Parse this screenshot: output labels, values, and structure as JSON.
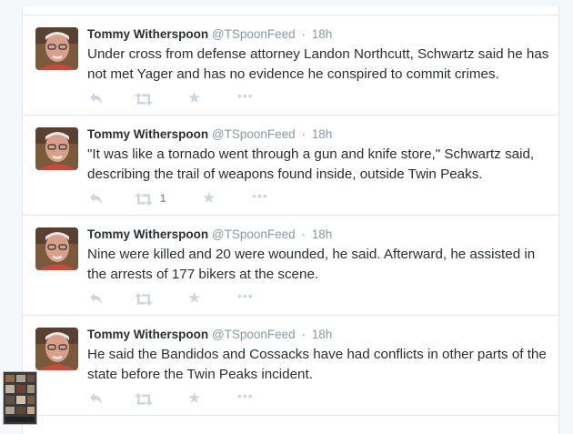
{
  "colors": {
    "background": "#f5f8fa",
    "card": "#ffffff",
    "border": "#e1e8ed",
    "name": "#292f33",
    "muted": "#8899a6",
    "icon": "#ccd6dd"
  },
  "icons": {
    "reply": "reply-icon",
    "retweet": "retweet-icon",
    "favorite": "star-icon",
    "more": "more-icon"
  },
  "tweets": [
    {
      "fullname": "Tommy Witherspoon",
      "handle": "@TSpoonFeed",
      "separator": "·",
      "time": "18h",
      "text": "Under cross from defense attorney Landon Northcutt, Schwartz said he has not met Yager and has no evidence he conspired to commit crimes.",
      "retweet_count": ""
    },
    {
      "fullname": "Tommy Witherspoon",
      "handle": "@TSpoonFeed",
      "separator": "·",
      "time": "18h",
      "text": "\"It was like a tornado went through a gun and knife store,\" Schwartz said, describing the trail of weapons found inside, outside Twin Peaks.",
      "retweet_count": "1"
    },
    {
      "fullname": "Tommy Witherspoon",
      "handle": "@TSpoonFeed",
      "separator": "·",
      "time": "18h",
      "text": "Nine were killed and 20 were wounded, he said. Afterward, he assisted in the arrests of 177 bikers at the scene.",
      "retweet_count": ""
    },
    {
      "fullname": "Tommy Witherspoon",
      "handle": "@TSpoonFeed",
      "separator": "·",
      "time": "18h",
      "text": "He said the Bandidos and Cossacks have had conflicts in other parts of the state before the Twin Peaks incident.",
      "retweet_count": ""
    }
  ]
}
